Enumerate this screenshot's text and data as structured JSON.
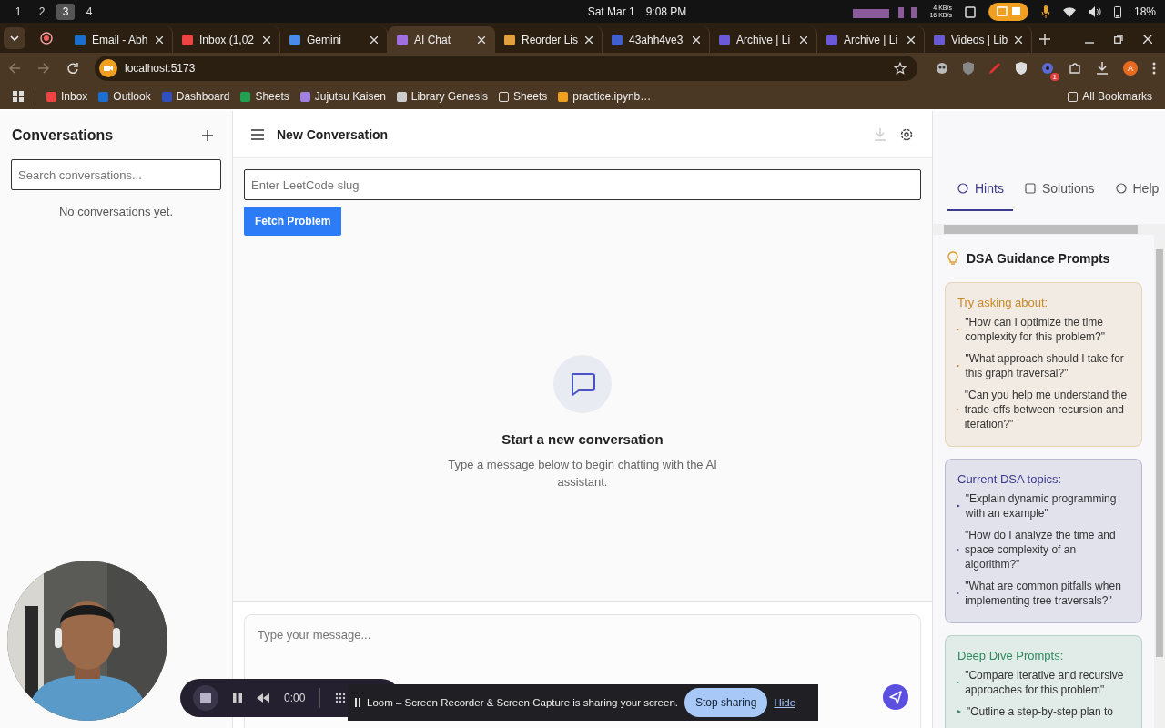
{
  "os_bar": {
    "workspaces": [
      {
        "label": "1",
        "selected": false
      },
      {
        "label": "2",
        "selected": false
      },
      {
        "label": "3",
        "selected": true
      },
      {
        "label": "4",
        "selected": false
      }
    ],
    "date": "Sat Mar 1",
    "time": "9:08 PM",
    "net_up": "4 KB/s",
    "net_down": "16 KB/s",
    "battery": "18%"
  },
  "browser": {
    "tabs": [
      {
        "title": "Email - Abh",
        "selected": false
      },
      {
        "title": "Inbox (1,02",
        "selected": false
      },
      {
        "title": "Gemini",
        "selected": false
      },
      {
        "title": "AI Chat",
        "selected": true
      },
      {
        "title": "Reorder Lis",
        "selected": false
      },
      {
        "title": "43ahh4ve3",
        "selected": false
      },
      {
        "title": "Archive | Li",
        "selected": false
      },
      {
        "title": "Archive | Li",
        "selected": false
      },
      {
        "title": "Videos | Lib",
        "selected": false
      }
    ],
    "address": "localhost:5173",
    "extension_badge": "1",
    "profile_initial": "A",
    "bookmarks": [
      {
        "label": "Inbox"
      },
      {
        "label": "Outlook"
      },
      {
        "label": "Dashboard"
      },
      {
        "label": "Sheets"
      },
      {
        "label": "Jujutsu Kaisen"
      },
      {
        "label": "Library Genesis"
      },
      {
        "label": "Sheets"
      },
      {
        "label": "practice.ipynb…"
      }
    ],
    "all_bookmarks": "All Bookmarks"
  },
  "sidebar": {
    "title": "Conversations",
    "search_placeholder": "Search conversations...",
    "empty_text": "No conversations yet."
  },
  "main": {
    "title": "New Conversation",
    "slug_placeholder": "Enter LeetCode slug",
    "fetch_button": "Fetch Problem",
    "empty_title": "Start a new conversation",
    "empty_text": "Type a message below to begin chatting with the AI assistant.",
    "message_placeholder": "Type your message..."
  },
  "panel": {
    "tabs": [
      {
        "label": "Hints",
        "selected": true
      },
      {
        "label": "Solutions",
        "selected": false
      },
      {
        "label": "Help",
        "selected": false
      }
    ],
    "heading": "DSA Guidance Prompts",
    "sections": [
      {
        "title": "Try asking about:",
        "color": "#c8892a",
        "prompts": [
          "\"How can I optimize the time complexity for this problem?\"",
          "\"What approach should I take for this graph traversal?\"",
          "\"Can you help me understand the trade-offs between recursion and iteration?\""
        ]
      },
      {
        "title": "Current DSA topics:",
        "color": "#3b3a8c",
        "prompts": [
          "\"Explain dynamic programming with an example\"",
          "\"How do I analyze the time and space complexity of an algorithm?\"",
          "\"What are common pitfalls when implementing tree traversals?\""
        ]
      },
      {
        "title": "Deep Dive Prompts:",
        "color": "#2e8a5e",
        "prompts": [
          "\"Compare iterative and recursive approaches for this problem\"",
          "\"Outline a step-by-step plan to"
        ]
      }
    ]
  },
  "recorder": {
    "timer": "0:00",
    "share_message": "Loom – Screen Recorder & Screen Capture is sharing your screen.",
    "stop_button": "Stop sharing",
    "hide_link": "Hide"
  }
}
